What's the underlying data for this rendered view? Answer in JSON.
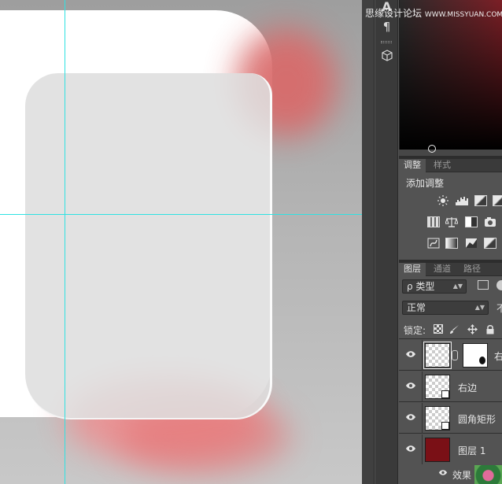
{
  "watermark": {
    "text": "思缘设计论坛",
    "url": "WWW.MISSYUAN.COM"
  },
  "colors": {
    "accent_red": "#7a1016",
    "guide": "#2fe2e2",
    "panel_bg": "#535353"
  },
  "toolstrip": {
    "character_icon": "A",
    "paragraph_icon": "¶"
  },
  "adjustments": {
    "tabs": [
      {
        "label": "调整",
        "active": true
      },
      {
        "label": "样式",
        "active": false
      }
    ],
    "add_label": "添加调整"
  },
  "layers": {
    "tabs": [
      {
        "label": "图层",
        "active": true
      },
      {
        "label": "通道",
        "active": false
      },
      {
        "label": "路径",
        "active": false
      }
    ],
    "filter_label": "ρ 类型",
    "blend_mode": "正常",
    "opacity_label": "不",
    "lock_label": "锁定:",
    "rows": [
      {
        "name": "右",
        "type": "masked",
        "visible": true
      },
      {
        "name": "右边",
        "type": "shape",
        "visible": true
      },
      {
        "name": "圆角矩形",
        "type": "shape",
        "visible": true
      },
      {
        "name": "图层 1",
        "type": "fill",
        "visible": true
      }
    ],
    "effect_label": "效果"
  }
}
